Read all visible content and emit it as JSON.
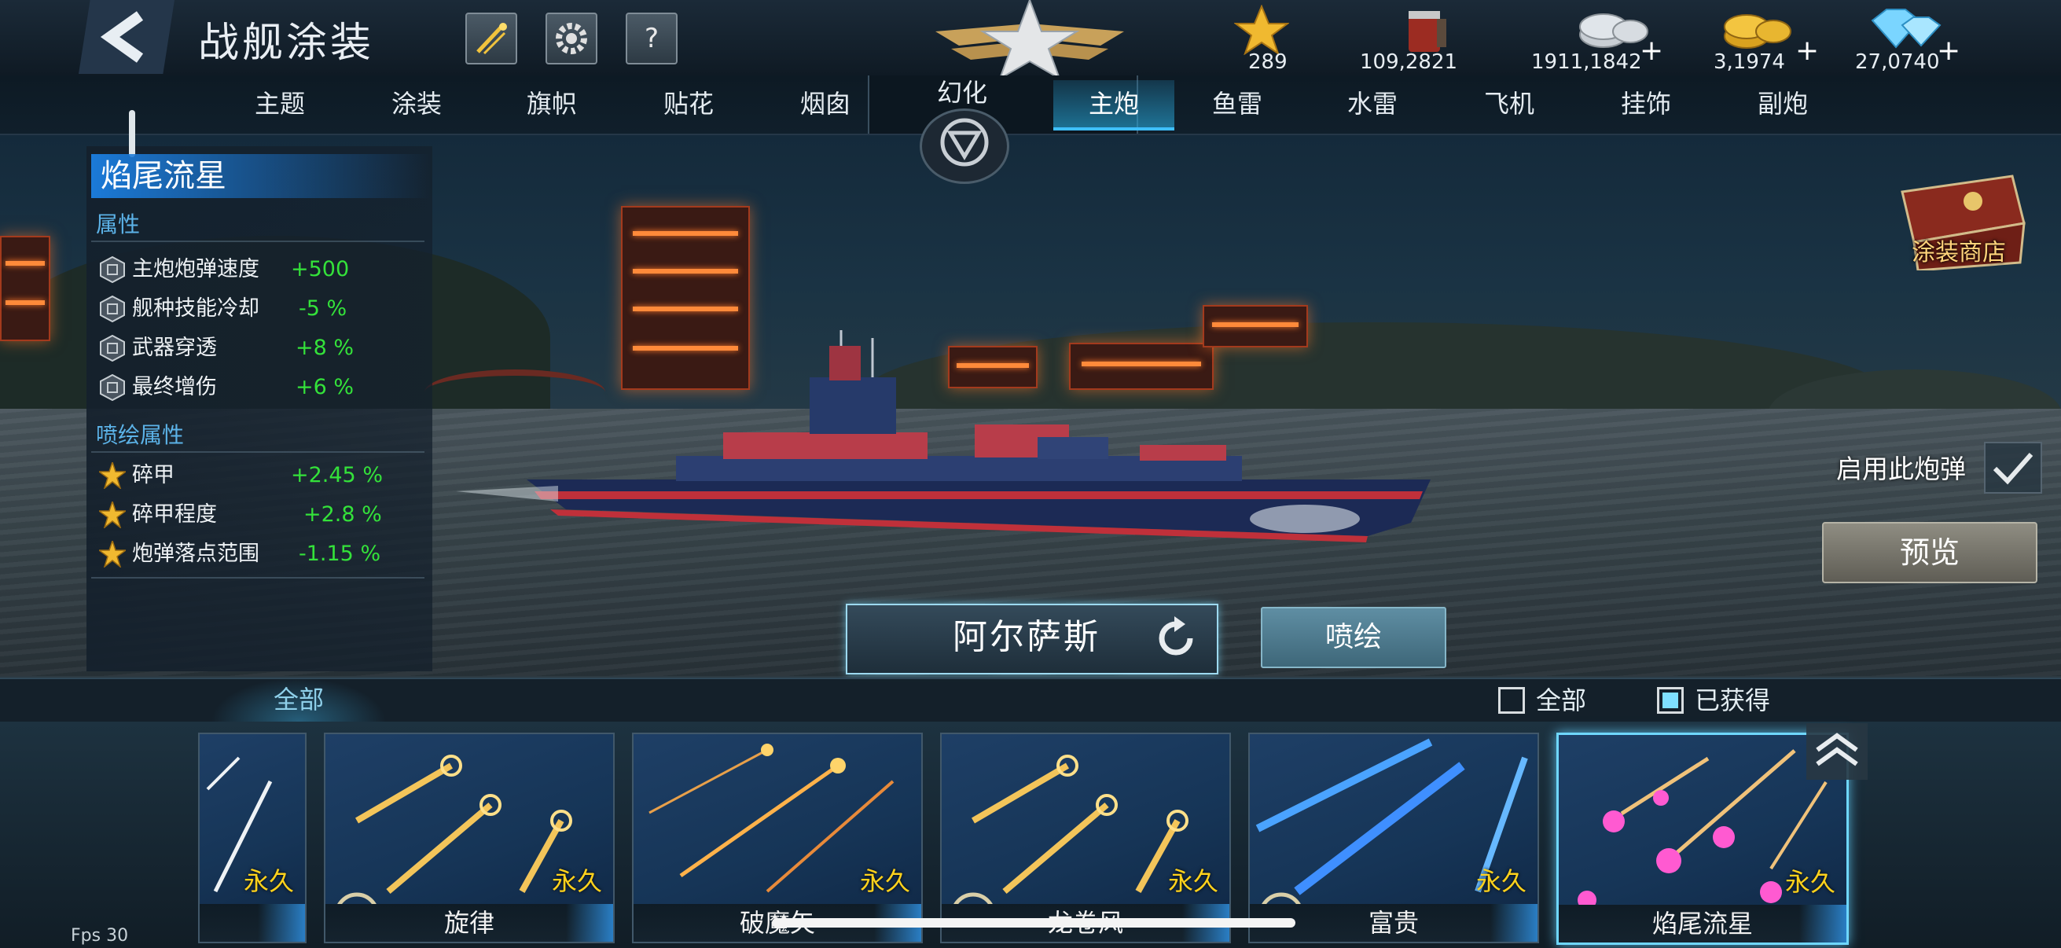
{
  "header": {
    "title": "战舰涂装",
    "buttons": {
      "fireworks_icon": "fireworks-icon",
      "settings_icon": "gear-icon",
      "help_label": "?"
    }
  },
  "currencies": [
    {
      "name": "star-icon",
      "value": "289",
      "plus": ""
    },
    {
      "name": "paint-bucket-icon",
      "value": "109,2821",
      "plus": ""
    },
    {
      "name": "silver-coin-icon",
      "value": "1911,1842",
      "plus": "+"
    },
    {
      "name": "gold-coin-icon",
      "value": "3,1974",
      "plus": "+"
    },
    {
      "name": "diamond-icon",
      "value": "27,0740",
      "plus": "+"
    }
  ],
  "tabs": {
    "left": [
      "主题",
      "涂装",
      "旗帜",
      "贴花",
      "烟囱"
    ],
    "center": "幻化",
    "right": [
      "主炮",
      "鱼雷",
      "水雷",
      "飞机",
      "挂饰",
      "副炮"
    ],
    "active": "主炮"
  },
  "panel": {
    "skin_name": "焰尾流星",
    "attr_title": "属性",
    "attributes": [
      {
        "label": "主炮炮弹速度",
        "value": "+500"
      },
      {
        "label": "舰种技能冷却",
        "value": "-5 %"
      },
      {
        "label": "武器穿透",
        "value": "+8 %"
      },
      {
        "label": "最终增伤",
        "value": "+6 %"
      }
    ],
    "paint_title": "喷绘属性",
    "paint_attributes": [
      {
        "label": "碎甲",
        "value": "+2.45 %"
      },
      {
        "label": "碎甲程度",
        "value": "+2.8 %"
      },
      {
        "label": "炮弹落点范围",
        "value": "-1.15 %"
      }
    ]
  },
  "right": {
    "shop_label": "涂装商店",
    "enable_label": "启用此炮弹",
    "preview_label": "预览"
  },
  "center": {
    "ship_name": "阿尔萨斯",
    "paint_button": "喷绘"
  },
  "filters": {
    "tab_all": "全部",
    "check_all": "全部",
    "check_owned": "已获得"
  },
  "cards": [
    {
      "name": "",
      "duration": "永久",
      "style": "white"
    },
    {
      "name": "旋律",
      "duration": "永久",
      "style": "gold"
    },
    {
      "name": "破魔矢",
      "duration": "永久",
      "style": "gold-streak"
    },
    {
      "name": "龙卷风",
      "duration": "永久",
      "style": "gold"
    },
    {
      "name": "富贵",
      "duration": "永久",
      "style": "blue"
    },
    {
      "name": "焰尾流星",
      "duration": "永久",
      "style": "pink"
    }
  ],
  "footer": {
    "fps": "Fps 30"
  },
  "colors": {
    "accent": "#3fc0ff",
    "positive": "#34e23a",
    "gold": "#ffd21c",
    "section": "#5cb3e8"
  }
}
